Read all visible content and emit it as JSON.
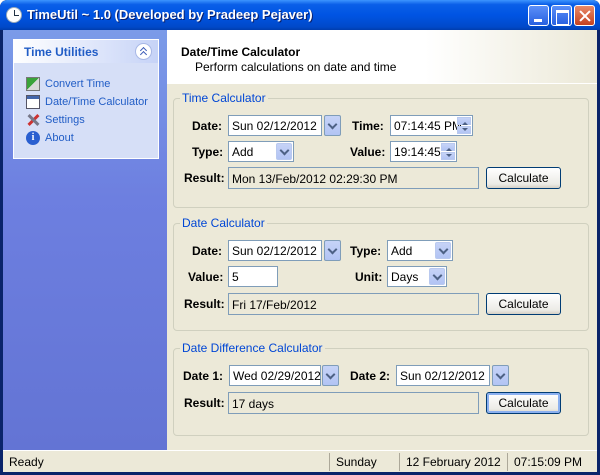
{
  "window": {
    "title": "TimeUtil ~ 1.0 (Developed by Pradeep Pejaver)"
  },
  "sidebar": {
    "title": "Time Utilities",
    "items": [
      {
        "label": "Convert Time",
        "icon": "convert-icon"
      },
      {
        "label": "Date/Time Calculator",
        "icon": "calendar-icon"
      },
      {
        "label": "Settings",
        "icon": "tools-icon"
      },
      {
        "label": "About",
        "icon": "info-icon"
      }
    ]
  },
  "header": {
    "title": "Date/Time Calculator",
    "subtitle": "Perform calculations on date and time"
  },
  "time_calc": {
    "group_title": "Time Calculator",
    "date_label": "Date:",
    "date_value": "Sun 02/12/2012",
    "time_label": "Time:",
    "time_value": "07:14:45 PM",
    "type_label": "Type:",
    "type_value": "Add",
    "value_label": "Value:",
    "value_value": "19:14:45",
    "result_label": "Result:",
    "result_value": "Mon 13/Feb/2012 02:29:30 PM",
    "calc_label": "Calculate"
  },
  "date_calc": {
    "group_title": "Date Calculator",
    "date_label": "Date:",
    "date_value": "Sun 02/12/2012",
    "type_label": "Type:",
    "type_value": "Add",
    "value_label": "Value:",
    "value_value": "5",
    "unit_label": "Unit:",
    "unit_value": "Days",
    "result_label": "Result:",
    "result_value": "Fri 17/Feb/2012",
    "calc_label": "Calculate"
  },
  "diff_calc": {
    "group_title": "Date Difference Calculator",
    "date1_label": "Date 1:",
    "date1_value": "Wed 02/29/2012",
    "date2_label": "Date 2:",
    "date2_value": "Sun 02/12/2012",
    "result_label": "Result:",
    "result_value": "17 days",
    "calc_label": "Calculate"
  },
  "statusbar": {
    "status": "Ready",
    "day": "Sunday",
    "date": "12 February 2012",
    "time": "07:15:09 PM"
  }
}
